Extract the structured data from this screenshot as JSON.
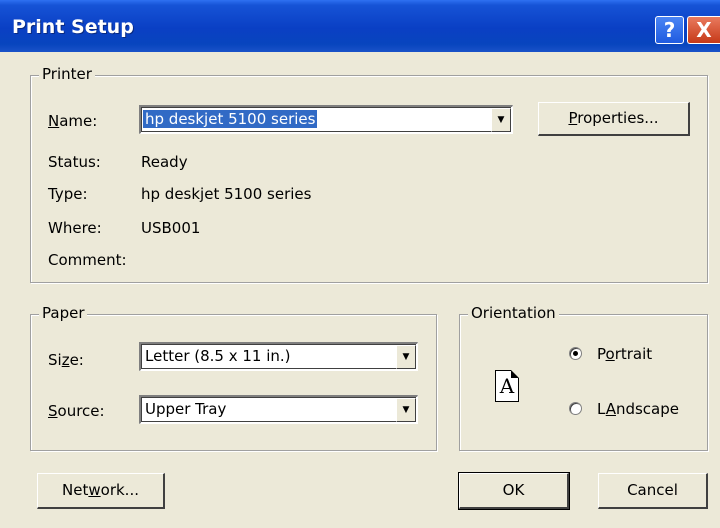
{
  "window": {
    "title": "Print Setup",
    "help_glyph": "?",
    "close_glyph": "X",
    "colors": {
      "titlebar": "#0A3FC4",
      "face": "#ECE9D8",
      "selection": "#316AC5"
    }
  },
  "printer": {
    "legend": "Printer",
    "name_label_prefix": "N",
    "name_label_rest": "ame:",
    "name_value": "hp deskjet 5100 series",
    "properties_prefix": "P",
    "properties_rest": "roperties...",
    "status_label": "Status:",
    "status_value": "Ready",
    "type_label": "Type:",
    "type_value": "hp deskjet 5100 series",
    "where_label": "Where:",
    "where_value": "USB001",
    "comment_label": "Comment:",
    "comment_value": ""
  },
  "paper": {
    "legend": "Paper",
    "size_label_a": "Si",
    "size_label_u": "z",
    "size_label_b": "e:",
    "size_value": "Letter (8.5 x 11 in.)",
    "source_label_u": "S",
    "source_label_rest": "ource:",
    "source_value": "Upper Tray"
  },
  "orientation": {
    "legend": "Orientation",
    "portrait_u": "o",
    "portrait_a": "P",
    "portrait_b": "rtrait",
    "landscape_u": "A",
    "landscape_a": "L",
    "landscape_b": "ndscape",
    "selected": "portrait",
    "page_letter": "A"
  },
  "buttons": {
    "network_a": "Net",
    "network_u": "w",
    "network_b": "ork...",
    "ok": "OK",
    "cancel": "Cancel"
  },
  "icons": [
    "help-icon",
    "close-icon",
    "dropdown-arrow-icon",
    "portrait-page-icon"
  ]
}
